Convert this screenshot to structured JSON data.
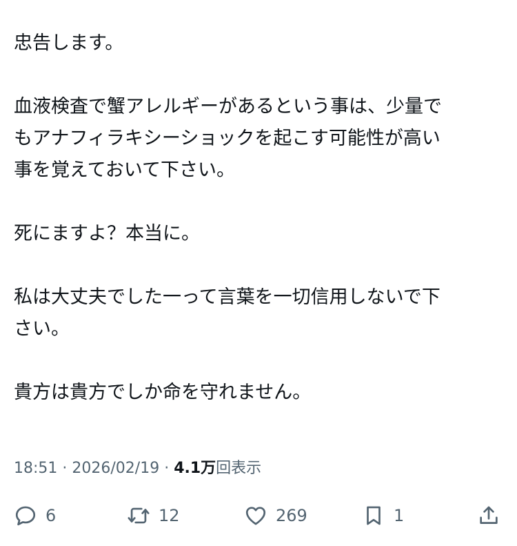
{
  "tweet": {
    "paragraphs": [
      [
        "忠告します。"
      ],
      [
        "血液検査で蟹アレルギーがあるという事は、少量で",
        "もアナフィラキシーショックを起こす可能性が高い",
        "事を覚えておいて下さい。"
      ],
      [
        "死にますよ？本当に。"
      ],
      [
        "私は大丈夫でした一って言葉を一切信用しないで下",
        "さい。"
      ],
      [
        "貴方は貴方でしか命を守れません。"
      ]
    ]
  },
  "meta": {
    "time": "18:51",
    "separator": " · ",
    "date": "2026/02/19",
    "views_count": "4.1万",
    "views_label": "回表示"
  },
  "actions": {
    "reply": {
      "icon": "reply-icon",
      "count": "6"
    },
    "retweet": {
      "icon": "retweet-icon",
      "count": "12"
    },
    "like": {
      "icon": "heart-icon",
      "count": "269"
    },
    "bookmark": {
      "icon": "bookmark-icon",
      "count": "1"
    },
    "share": {
      "icon": "share-icon"
    }
  },
  "colors": {
    "text": "#0f1419",
    "secondary": "#536471",
    "background": "#ffffff"
  }
}
